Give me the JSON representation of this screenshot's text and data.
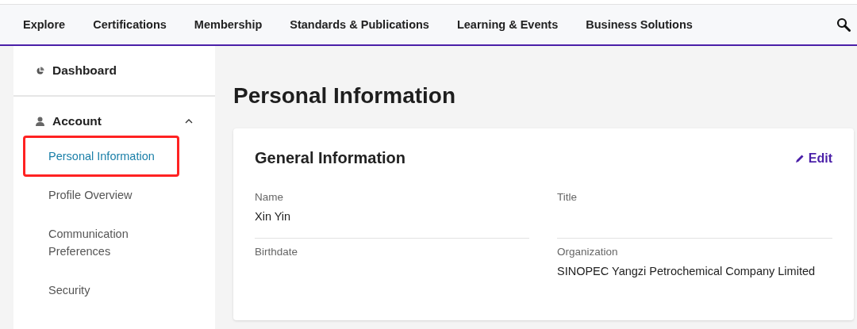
{
  "nav": {
    "items": [
      "Explore",
      "Certifications",
      "Membership",
      "Standards & Publications",
      "Learning & Events",
      "Business Solutions"
    ]
  },
  "sidebar": {
    "sections": [
      {
        "label": "Dashboard",
        "kind": "chart"
      },
      {
        "label": "Account",
        "kind": "person",
        "expanded": true,
        "items": [
          {
            "label": "Personal Information",
            "selected": true
          },
          {
            "label": "Profile Overview",
            "selected": false
          },
          {
            "label": "Communication Preferences",
            "selected": false
          },
          {
            "label": "Security",
            "selected": false
          }
        ]
      }
    ]
  },
  "page_title": "Personal Information",
  "card": {
    "title": "General Information",
    "edit": "Edit",
    "fields": [
      {
        "label": "Name",
        "value": "Xin Yin"
      },
      {
        "label": "Title"
      },
      {
        "label": "Birthdate"
      },
      {
        "label": "Organization",
        "value": "SINOPEC Yangzi Petrochemical Company Limited"
      }
    ]
  }
}
